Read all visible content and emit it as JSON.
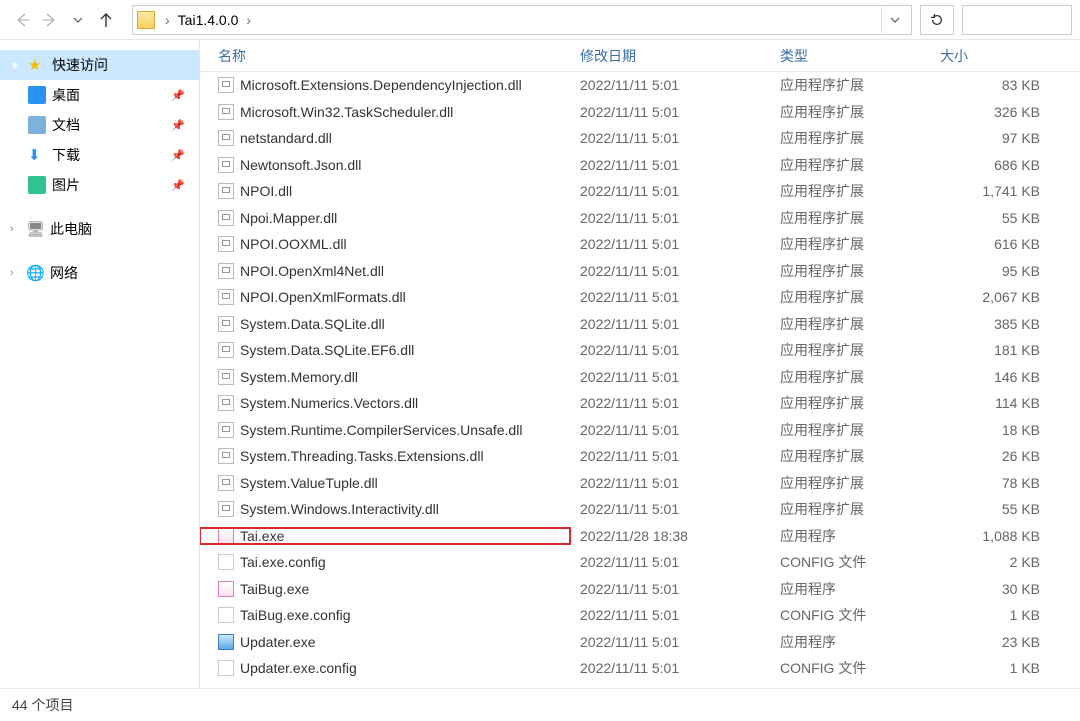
{
  "breadcrumb": {
    "folder": "Tai1.4.0.0"
  },
  "sidebar": {
    "quick_access": "快速访问",
    "desktop": "桌面",
    "documents": "文档",
    "downloads": "下载",
    "pictures": "图片",
    "this_pc": "此电脑",
    "network": "网络"
  },
  "columns": {
    "name": "名称",
    "date": "修改日期",
    "type": "类型",
    "size": "大小"
  },
  "files": [
    {
      "icon": "dll",
      "name": "Microsoft.Extensions.DependencyInjection.dll",
      "date": "2022/11/11 5:01",
      "type": "应用程序扩展",
      "size": "83 KB"
    },
    {
      "icon": "dll",
      "name": "Microsoft.Win32.TaskScheduler.dll",
      "date": "2022/11/11 5:01",
      "type": "应用程序扩展",
      "size": "326 KB"
    },
    {
      "icon": "dll",
      "name": "netstandard.dll",
      "date": "2022/11/11 5:01",
      "type": "应用程序扩展",
      "size": "97 KB"
    },
    {
      "icon": "dll",
      "name": "Newtonsoft.Json.dll",
      "date": "2022/11/11 5:01",
      "type": "应用程序扩展",
      "size": "686 KB"
    },
    {
      "icon": "dll",
      "name": "NPOI.dll",
      "date": "2022/11/11 5:01",
      "type": "应用程序扩展",
      "size": "1,741 KB"
    },
    {
      "icon": "dll",
      "name": "Npoi.Mapper.dll",
      "date": "2022/11/11 5:01",
      "type": "应用程序扩展",
      "size": "55 KB"
    },
    {
      "icon": "dll",
      "name": "NPOI.OOXML.dll",
      "date": "2022/11/11 5:01",
      "type": "应用程序扩展",
      "size": "616 KB"
    },
    {
      "icon": "dll",
      "name": "NPOI.OpenXml4Net.dll",
      "date": "2022/11/11 5:01",
      "type": "应用程序扩展",
      "size": "95 KB"
    },
    {
      "icon": "dll",
      "name": "NPOI.OpenXmlFormats.dll",
      "date": "2022/11/11 5:01",
      "type": "应用程序扩展",
      "size": "2,067 KB"
    },
    {
      "icon": "dll",
      "name": "System.Data.SQLite.dll",
      "date": "2022/11/11 5:01",
      "type": "应用程序扩展",
      "size": "385 KB"
    },
    {
      "icon": "dll",
      "name": "System.Data.SQLite.EF6.dll",
      "date": "2022/11/11 5:01",
      "type": "应用程序扩展",
      "size": "181 KB"
    },
    {
      "icon": "dll",
      "name": "System.Memory.dll",
      "date": "2022/11/11 5:01",
      "type": "应用程序扩展",
      "size": "146 KB"
    },
    {
      "icon": "dll",
      "name": "System.Numerics.Vectors.dll",
      "date": "2022/11/11 5:01",
      "type": "应用程序扩展",
      "size": "114 KB"
    },
    {
      "icon": "dll",
      "name": "System.Runtime.CompilerServices.Unsafe.dll",
      "date": "2022/11/11 5:01",
      "type": "应用程序扩展",
      "size": "18 KB"
    },
    {
      "icon": "dll",
      "name": "System.Threading.Tasks.Extensions.dll",
      "date": "2022/11/11 5:01",
      "type": "应用程序扩展",
      "size": "26 KB"
    },
    {
      "icon": "dll",
      "name": "System.ValueTuple.dll",
      "date": "2022/11/11 5:01",
      "type": "应用程序扩展",
      "size": "78 KB"
    },
    {
      "icon": "dll",
      "name": "System.Windows.Interactivity.dll",
      "date": "2022/11/11 5:01",
      "type": "应用程序扩展",
      "size": "55 KB"
    },
    {
      "icon": "exe-pink",
      "name": "Tai.exe",
      "date": "2022/11/28 18:38",
      "type": "应用程序",
      "size": "1,088 KB",
      "highlight": true
    },
    {
      "icon": "config",
      "name": "Tai.exe.config",
      "date": "2022/11/11 5:01",
      "type": "CONFIG 文件",
      "size": "2 KB"
    },
    {
      "icon": "exe-pink",
      "name": "TaiBug.exe",
      "date": "2022/11/11 5:01",
      "type": "应用程序",
      "size": "30 KB"
    },
    {
      "icon": "config",
      "name": "TaiBug.exe.config",
      "date": "2022/11/11 5:01",
      "type": "CONFIG 文件",
      "size": "1 KB"
    },
    {
      "icon": "exe-app",
      "name": "Updater.exe",
      "date": "2022/11/11 5:01",
      "type": "应用程序",
      "size": "23 KB"
    },
    {
      "icon": "config",
      "name": "Updater.exe.config",
      "date": "2022/11/11 5:01",
      "type": "CONFIG 文件",
      "size": "1 KB"
    }
  ],
  "status": "44 个项目"
}
